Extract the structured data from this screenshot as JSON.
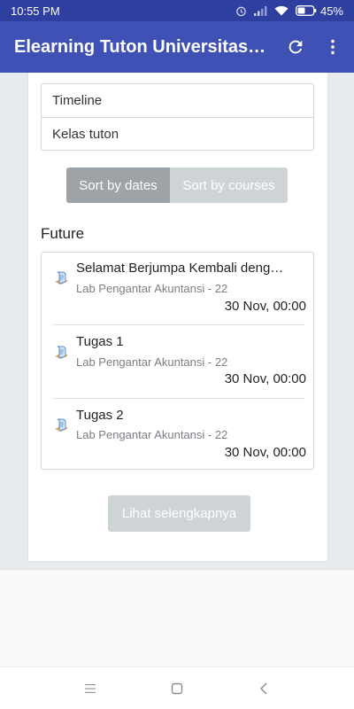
{
  "status_bar": {
    "time": "10:55 PM",
    "battery": "45%",
    "icons": [
      "alarm-icon",
      "signal-icon",
      "wifi-icon",
      "battery-icon"
    ]
  },
  "app_bar": {
    "title": "Elearning Tuton Universitas T...",
    "actions": [
      "refresh-icon",
      "more-vert-icon"
    ],
    "color": "#3f51b5"
  },
  "filters": [
    "Timeline",
    "Kelas tuton"
  ],
  "sort": {
    "dates_label": "Sort by dates",
    "courses_label": "Sort by courses",
    "selected": "Sort by dates"
  },
  "section": {
    "title": "Future"
  },
  "events": [
    {
      "name": "Selamat Berjumpa Kembali denga...",
      "course": "Lab Pengantar Akuntansi - 22",
      "date": "30 Nov, 00:00",
      "icon": "assignment-icon"
    },
    {
      "name": "Tugas 1",
      "course": "Lab Pengantar Akuntansi - 22",
      "date": "30 Nov, 00:00",
      "icon": "assignment-icon"
    },
    {
      "name": "Tugas 2",
      "course": "Lab Pengantar Akuntansi - 22",
      "date": "30 Nov, 00:00",
      "icon": "assignment-icon"
    }
  ],
  "more_button": {
    "label": "Lihat selengkapnya"
  },
  "nav_bar": {
    "buttons": [
      "menu-icon",
      "home-icon",
      "back-icon"
    ]
  }
}
